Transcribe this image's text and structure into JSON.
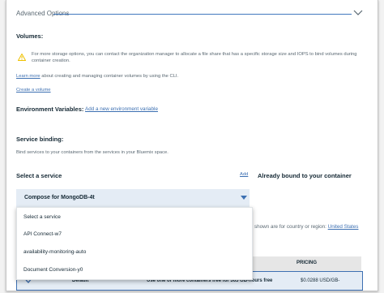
{
  "advanced": {
    "title": "Advanced Options"
  },
  "volumes": {
    "heading": "Volumes:",
    "warning": "For more storage options, you can contact the organization manager to allocate a file share that has a specific storage size and IOPS to bind volumes during container creation.",
    "learn_more_link": "Learn more",
    "learn_more_text": "about creating and managing container volumes by using the CLI.",
    "create_link": "Create a volume"
  },
  "env": {
    "heading": "Environment Variables:",
    "add_link": "Add a new environment variable"
  },
  "binding": {
    "heading": "Service binding:",
    "description": "Bind services to your containers from the services in your Bluemix space.",
    "select_label": "Select a service",
    "add_link": "Add",
    "already_bound": "Already bound to your container"
  },
  "select": {
    "value": "Compose for MongoDB-4t",
    "options": [
      "Select a service",
      "API Connect-w7",
      "availability-monitoring-auto",
      "Document Conversion-y0"
    ]
  },
  "pricing": {
    "note_prefix": "shown are for country or region:",
    "region_link": "United States",
    "header": "PRICING",
    "row_plan": "Default",
    "row_desc": "Use one or more containers free for 365 GB-hours free",
    "row_price": "$0.0288 USD/GB-"
  },
  "colors": {
    "accent": "#3d70b2",
    "select_bg": "#e4ecf5",
    "warning": "#efc100"
  }
}
